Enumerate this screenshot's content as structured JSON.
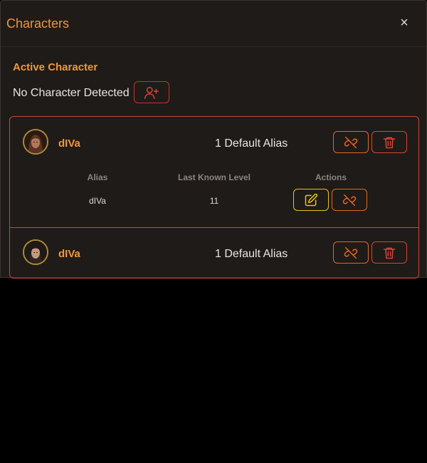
{
  "window": {
    "title": "Characters",
    "close_glyph": "×"
  },
  "active": {
    "heading": "Active Character",
    "status": "No Character Detected",
    "add_icon": "add-user-icon"
  },
  "table_headers": {
    "alias": "Alias",
    "level": "Last Known Level",
    "actions": "Actions"
  },
  "characters": [
    {
      "name": "dIVa",
      "alias_summary": "1 Default Alias",
      "expanded": true,
      "aliases": [
        {
          "alias": "dIVa",
          "level": "11"
        }
      ]
    },
    {
      "name": "dIVa",
      "alias_summary": "1 Default Alias",
      "expanded": false,
      "aliases": []
    }
  ],
  "colors": {
    "accent": "#f0963c",
    "danger": "#d8433a",
    "unlink": "#e8661f",
    "edit": "#e8c21f",
    "panel": "#1f1b18"
  }
}
